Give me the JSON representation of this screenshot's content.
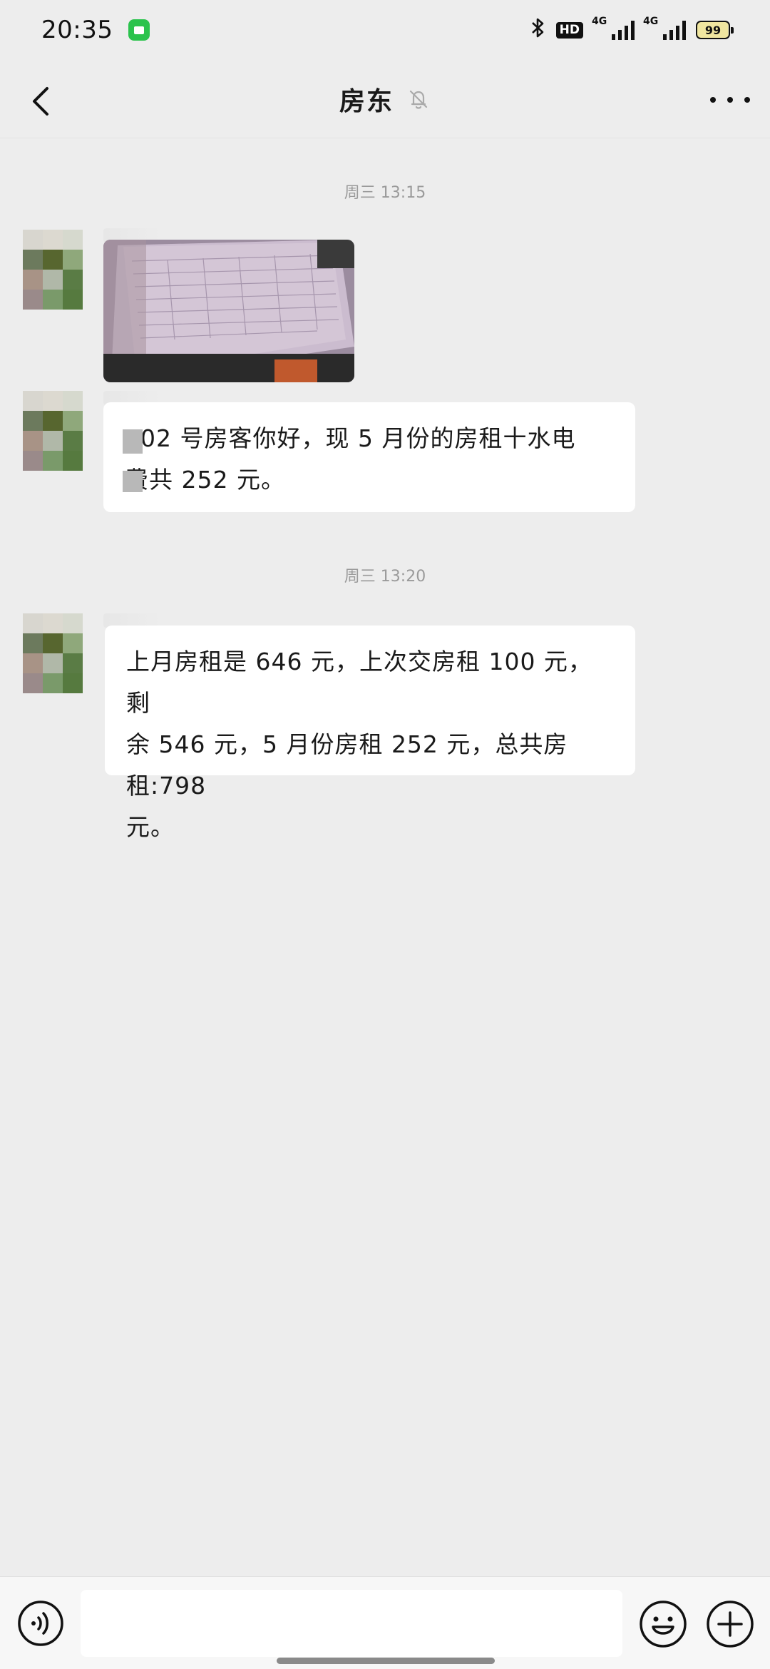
{
  "status_bar": {
    "time": "20:35",
    "app_icon": "message-app-icon",
    "bluetooth_icon": "bluetooth-icon",
    "hd_label": "HD",
    "signal1_label": "4G",
    "signal2_label": "4G",
    "battery_level": "99"
  },
  "nav": {
    "back_icon": "back-chevron-icon",
    "title": "房东",
    "mute_icon": "mute-bell-icon",
    "more_icon": "more-dots-icon"
  },
  "messages": [
    {
      "timestamp": "周三 13:15"
    },
    {
      "type": "image",
      "description_icon": "photo-thumbnail"
    },
    {
      "type": "text",
      "lines": [
        "402 号房客你好，现 5 月份的房租十水电",
        "费共 252 元。"
      ]
    },
    {
      "timestamp": "周三 13:20"
    },
    {
      "type": "text",
      "lines": [
        "上月房租是 646 元，上次交房租 100 元，剩",
        "余 546 元，5 月份房租 252 元，总共房租:798",
        "元。"
      ]
    }
  ],
  "input_bar": {
    "voice_icon": "voice-input-icon",
    "emoji_icon": "emoji-icon",
    "plus_icon": "plus-icon",
    "text_value": ""
  }
}
